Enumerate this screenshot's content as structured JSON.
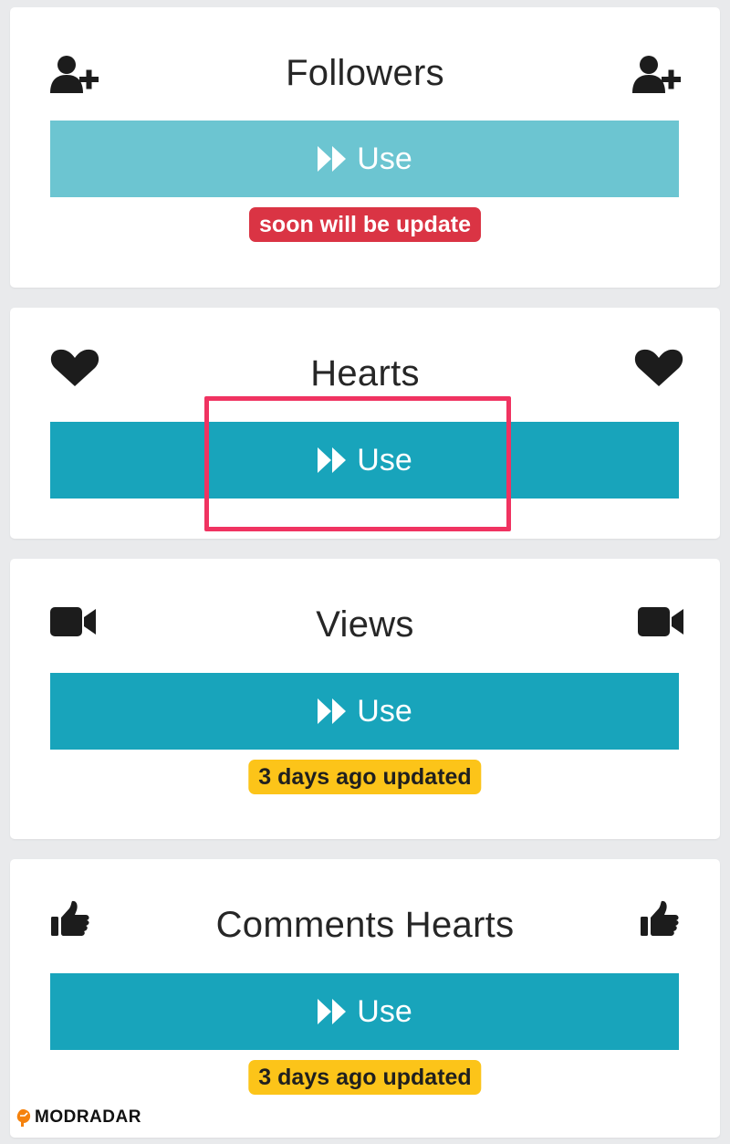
{
  "colors": {
    "button_active": "#18a4bb",
    "button_disabled": "#6cc5d1",
    "badge_red": "#da3444",
    "badge_yellow": "#fcc419",
    "highlight": "#f03361"
  },
  "cards": [
    {
      "title": "Followers",
      "icon": "user-plus-icon",
      "button_label": "Use",
      "button_state": "disabled",
      "badge": "soon will be update",
      "badge_color": "red"
    },
    {
      "title": "Hearts",
      "icon": "heart-icon",
      "button_label": "Use",
      "button_state": "active",
      "highlighted": true
    },
    {
      "title": "Views",
      "icon": "video-camera-icon",
      "button_label": "Use",
      "button_state": "active",
      "badge": "3 days ago updated",
      "badge_color": "yellow"
    },
    {
      "title": "Comments Hearts",
      "icon": "thumbs-up-icon",
      "button_label": "Use",
      "button_state": "active",
      "badge": "3 days ago updated",
      "badge_color": "yellow"
    }
  ],
  "watermark": {
    "text": "MODRADAR",
    "icon": "radar-logo-icon"
  }
}
